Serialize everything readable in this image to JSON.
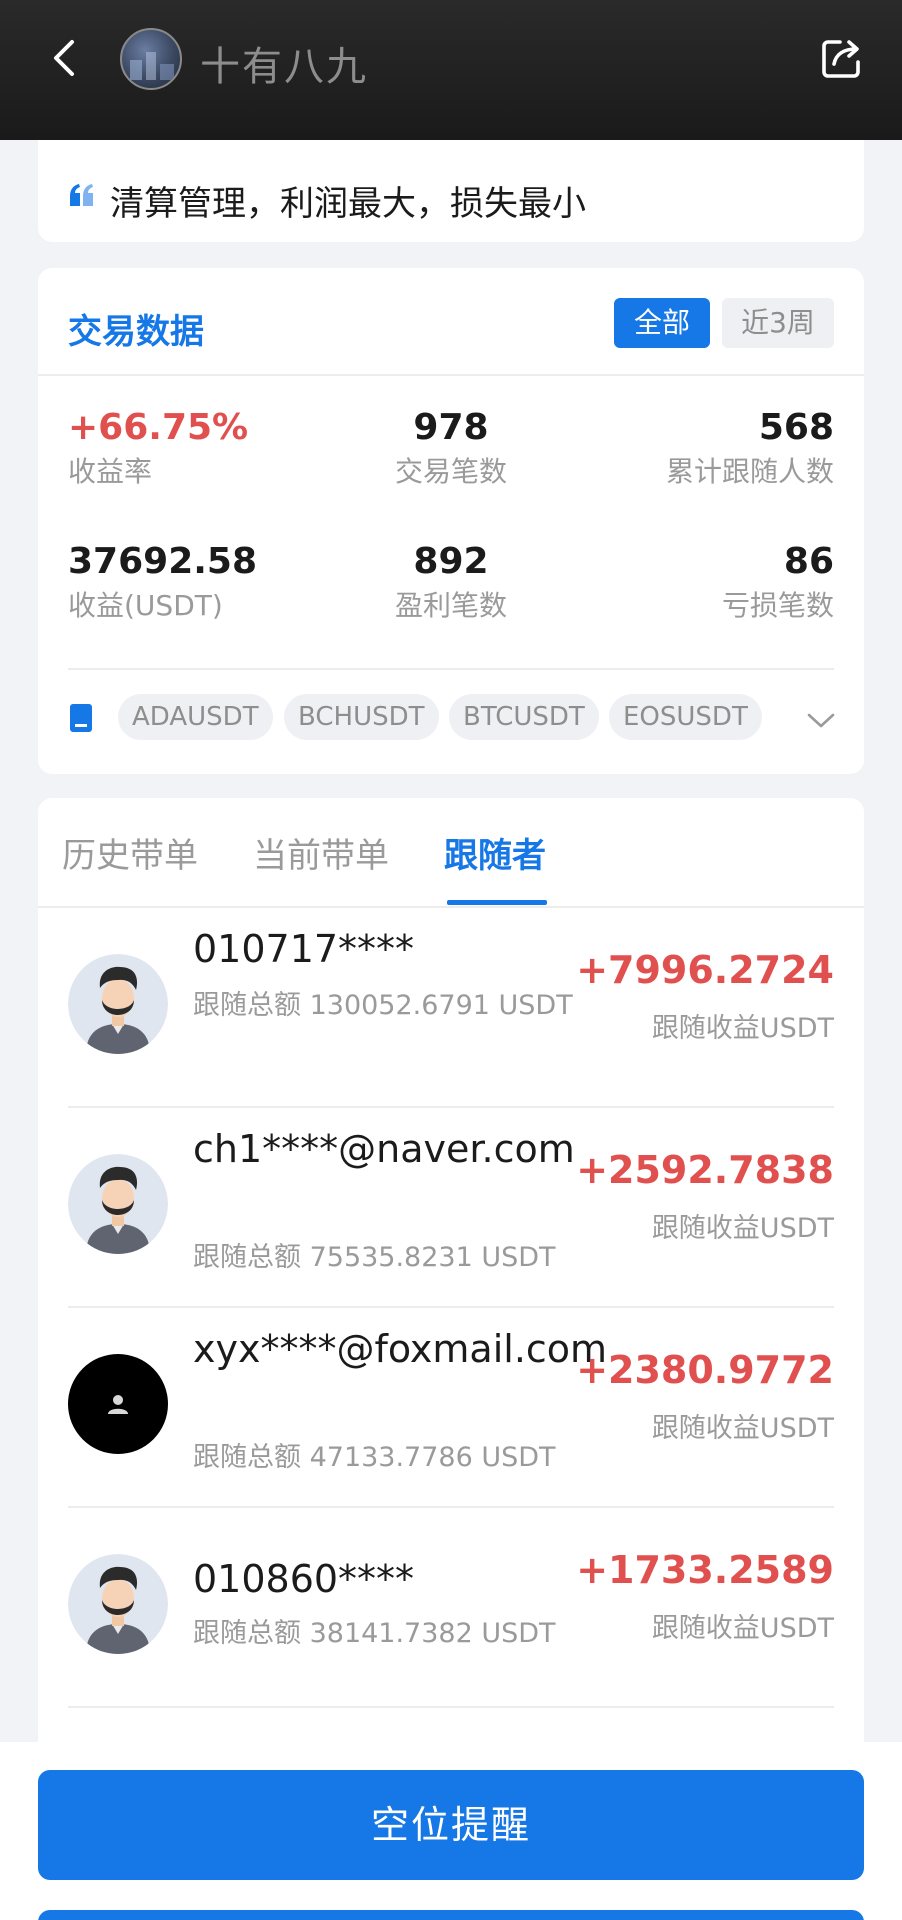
{
  "header": {
    "title": "十有八九"
  },
  "motto": {
    "text": "清算管理，利润最大，损失最小"
  },
  "trade_data": {
    "title": "交易数据",
    "segments": [
      "全部",
      "近3周"
    ],
    "stats": [
      {
        "value": "+66.75%",
        "label": "收益率"
      },
      {
        "value": "978",
        "label": "交易笔数"
      },
      {
        "value": "568",
        "label": "累计跟随人数"
      },
      {
        "value": "37692.58",
        "label": "收益(USDT)"
      },
      {
        "value": "892",
        "label": "盈利笔数"
      },
      {
        "value": "86",
        "label": "亏损笔数"
      }
    ],
    "tags": [
      "ADAUSDT",
      "BCHUSDT",
      "BTCUSDT",
      "EOSUSDT"
    ]
  },
  "tabs": [
    "历史带单",
    "当前带单",
    "跟随者"
  ],
  "followers": [
    {
      "name": "010717****",
      "amount": "跟随总额 130052.6791 USDT",
      "profit": "+7996.2724",
      "profit_label": "跟随收益USDT",
      "avatar": "bearded-man-avatar"
    },
    {
      "name": "ch1****@naver.com",
      "amount": "跟随总额 75535.8231 USDT",
      "profit": "+2592.7838",
      "profit_label": "跟随收益USDT",
      "avatar": "bearded-man-avatar"
    },
    {
      "name": "xyx****@foxmail.com",
      "amount": "跟随总额 47133.7786 USDT",
      "profit": "+2380.9772",
      "profit_label": "跟随收益USDT",
      "avatar": "default-user-avatar"
    },
    {
      "name": "010860****",
      "amount": "跟随总额 38141.7382 USDT",
      "profit": "+1733.2589",
      "profit_label": "跟随收益USDT",
      "avatar": "bearded-man-avatar"
    }
  ],
  "bottom": {
    "button_label": "空位提醒"
  },
  "colors": {
    "accent": "#1677e6",
    "profit": "#e0504f"
  }
}
